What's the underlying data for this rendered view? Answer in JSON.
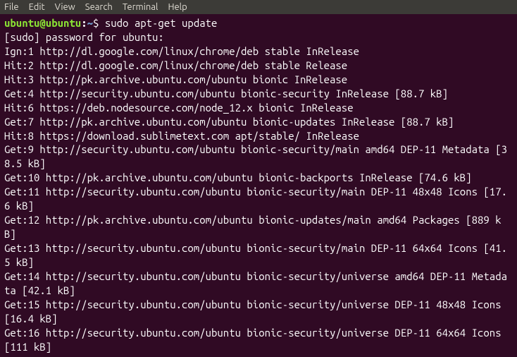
{
  "menubar": {
    "items": [
      "File",
      "Edit",
      "View",
      "Search",
      "Terminal",
      "Help"
    ]
  },
  "prompt": {
    "user": "ubuntu@ubuntu",
    "colon": ":",
    "path": "~",
    "symbol": "$"
  },
  "command": "sudo apt-get update",
  "output_lines": [
    "[sudo] password for ubuntu:",
    "Ign:1 http://dl.google.com/linux/chrome/deb stable InRelease",
    "Hit:2 http://dl.google.com/linux/chrome/deb stable Release",
    "Hit:3 http://pk.archive.ubuntu.com/ubuntu bionic InRelease",
    "Get:4 http://security.ubuntu.com/ubuntu bionic-security InRelease [88.7 kB]",
    "Hit:6 https://deb.nodesource.com/node_12.x bionic InRelease",
    "Get:7 http://pk.archive.ubuntu.com/ubuntu bionic-updates InRelease [88.7 kB]",
    "Hit:8 https://download.sublimetext.com apt/stable/ InRelease",
    "Get:9 http://security.ubuntu.com/ubuntu bionic-security/main amd64 DEP-11 Metadata [38.5 kB]",
    "Get:10 http://pk.archive.ubuntu.com/ubuntu bionic-backports InRelease [74.6 kB]",
    "Get:11 http://security.ubuntu.com/ubuntu bionic-security/main DEP-11 48x48 Icons [17.6 kB]",
    "Get:12 http://pk.archive.ubuntu.com/ubuntu bionic-updates/main amd64 Packages [889 kB]",
    "Get:13 http://security.ubuntu.com/ubuntu bionic-security/main DEP-11 64x64 Icons [41.5 kB]",
    "Get:14 http://security.ubuntu.com/ubuntu bionic-security/universe amd64 DEP-11 Metadata [42.1 kB]",
    "Get:15 http://security.ubuntu.com/ubuntu bionic-security/universe DEP-11 48x48 Icons [16.4 kB]",
    "Get:16 http://security.ubuntu.com/ubuntu bionic-security/universe DEP-11 64x64 Icons [111 kB]"
  ]
}
